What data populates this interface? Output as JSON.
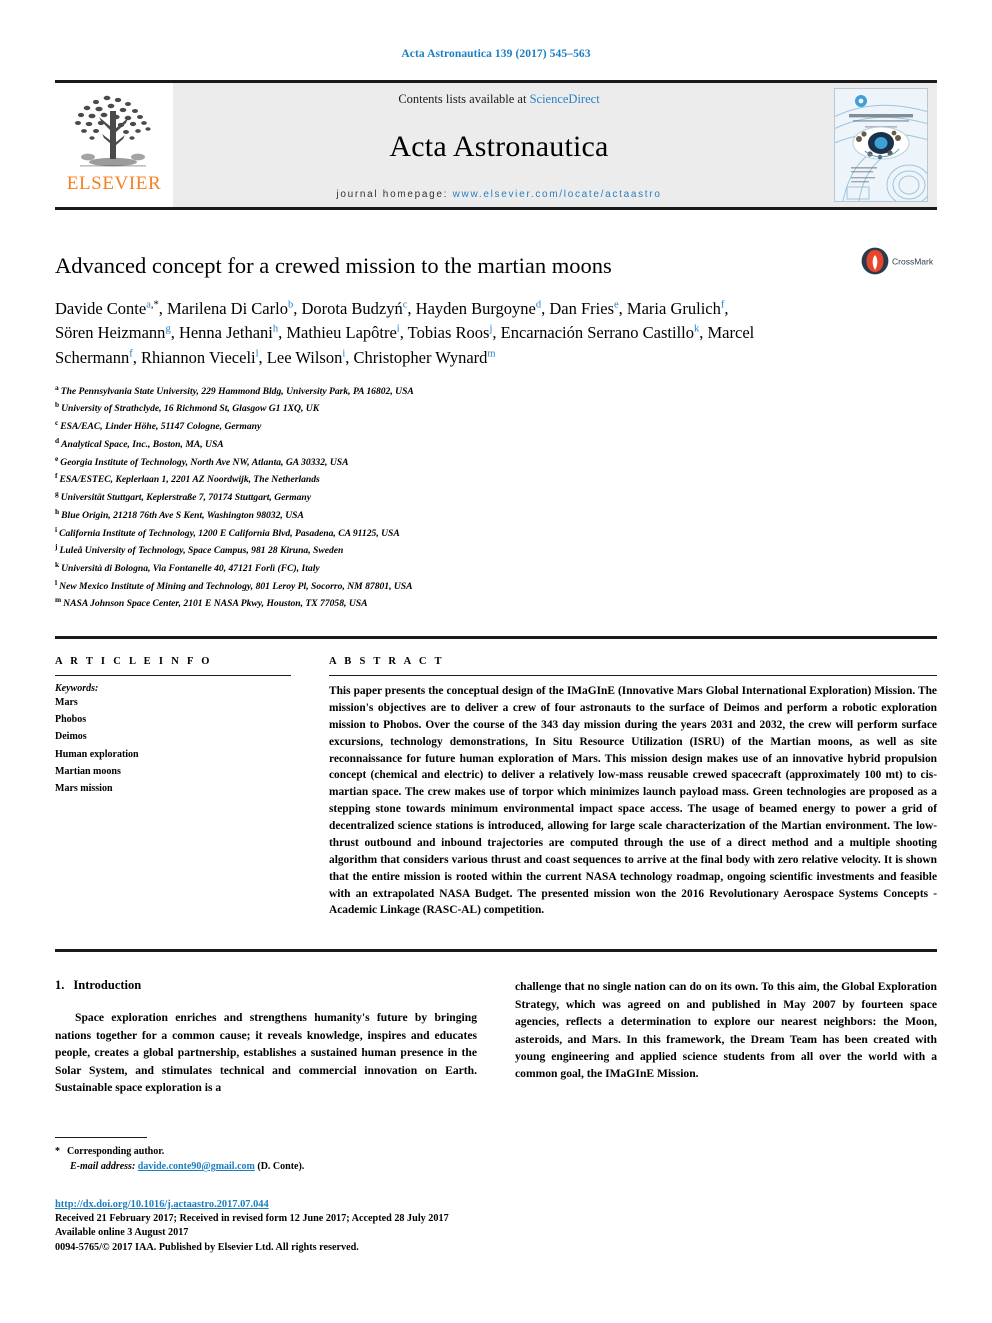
{
  "running_head": "Acta Astronautica 139 (2017) 545–563",
  "masthead": {
    "publisher_name": "ELSEVIER",
    "publisher_logo_icon": "elsevier-tree-icon",
    "contents_prefix": "Contents lists available at",
    "contents_link": "ScienceDirect",
    "journal_title": "Acta Astronautica",
    "homepage_label": "journal homepage:",
    "homepage_url": "www.elsevier.com/locate/actaastro",
    "cover_icon": "journal-cover-thumbnail"
  },
  "article": {
    "title": "Advanced concept for a crewed mission to the martian moons",
    "crossmark_label": "CrossMark",
    "crossmark_icon": "crossmark-badge-icon",
    "authors": [
      {
        "name": "Davide Conte",
        "marks": "a",
        "star": true,
        "sep": ", "
      },
      {
        "name": "Marilena Di Carlo",
        "marks": "b",
        "sep": ", "
      },
      {
        "name": "Dorota Budzyń",
        "marks": "c",
        "sep": ", "
      },
      {
        "name": "Hayden Burgoyne",
        "marks": "d",
        "sep": ", "
      },
      {
        "name": "Dan Fries",
        "marks": "e",
        "sep": ", "
      },
      {
        "name": "Maria Grulich",
        "marks": "f",
        "sep": ", "
      },
      {
        "name": "Sören Heizmann",
        "marks": "g",
        "sep": ", "
      },
      {
        "name": "Henna Jethani",
        "marks": "h",
        "sep": ", "
      },
      {
        "name": "Mathieu Lapôtre",
        "marks": "i",
        "sep": ", "
      },
      {
        "name": "Tobias Roos",
        "marks": "j",
        "sep": ", "
      },
      {
        "name": "Encarnación Serrano Castillo",
        "marks": "k",
        "sep": ", "
      },
      {
        "name": "Marcel Schermann",
        "marks": "f",
        "sep": ", "
      },
      {
        "name": "Rhiannon Vieceli",
        "marks": "l",
        "sep": ", "
      },
      {
        "name": "Lee Wilson",
        "marks": "i",
        "sep": ", "
      },
      {
        "name": "Christopher Wynard",
        "marks": "m",
        "sep": ""
      }
    ],
    "affiliations": [
      {
        "mark": "a",
        "text": "The Pennsylvania State University, 229 Hammond Bldg, University Park, PA 16802, USA"
      },
      {
        "mark": "b",
        "text": "University of Strathclyde, 16 Richmond St, Glasgow G1 1XQ, UK"
      },
      {
        "mark": "c",
        "text": "ESA/EAC, Linder Höhe, 51147 Cologne, Germany"
      },
      {
        "mark": "d",
        "text": "Analytical Space, Inc., Boston, MA, USA"
      },
      {
        "mark": "e",
        "text": "Georgia Institute of Technology, North Ave NW, Atlanta, GA 30332, USA"
      },
      {
        "mark": "f",
        "text": "ESA/ESTEC, Keplerlaan 1, 2201 AZ Noordwijk, The Netherlands"
      },
      {
        "mark": "g",
        "text": "Universität Stuttgart, Keplerstraße 7, 70174 Stuttgart, Germany"
      },
      {
        "mark": "h",
        "text": "Blue Origin, 21218 76th Ave S Kent, Washington 98032, USA"
      },
      {
        "mark": "i",
        "text": "California Institute of Technology, 1200 E California Blvd, Pasadena, CA 91125, USA"
      },
      {
        "mark": "j",
        "text": "Luleå University of Technology, Space Campus, 981 28 Kiruna, Sweden"
      },
      {
        "mark": "k",
        "text": "Università di Bologna, Via Fontanelle 40, 47121 Forlì (FC), Italy"
      },
      {
        "mark": "l",
        "text": "New Mexico Institute of Mining and Technology, 801 Leroy Pl, Socorro, NM 87801, USA"
      },
      {
        "mark": "m",
        "text": "NASA Johnson Space Center, 2101 E NASA Pkwy, Houston, TX 77058, USA"
      }
    ]
  },
  "article_info": {
    "heading": "A R T I C L E   I N F O",
    "keywords_label": "Keywords:",
    "keywords": [
      "Mars",
      "Phobos",
      "Deimos",
      "Human exploration",
      "Martian moons",
      "Mars mission"
    ]
  },
  "abstract": {
    "heading": "A B S T R A C T",
    "text": "This paper presents the conceptual design of the IMaGInE (Innovative Mars Global International Exploration) Mission. The mission's objectives are to deliver a crew of four astronauts to the surface of Deimos and perform a robotic exploration mission to Phobos. Over the course of the 343 day mission during the years 2031 and 2032, the crew will perform surface excursions, technology demonstrations, In Situ Resource Utilization (ISRU) of the Martian moons, as well as site reconnaissance for future human exploration of Mars. This mission design makes use of an innovative hybrid propulsion concept (chemical and electric) to deliver a relatively low-mass reusable crewed spacecraft (approximately 100 mt) to cis-martian space. The crew makes use of torpor which minimizes launch payload mass. Green technologies are proposed as a stepping stone towards minimum environmental impact space access. The usage of beamed energy to power a grid of decentralized science stations is introduced, allowing for large scale characterization of the Martian environment. The low-thrust outbound and inbound trajectories are computed through the use of a direct method and a multiple shooting algorithm that considers various thrust and coast sequences to arrive at the final body with zero relative velocity. It is shown that the entire mission is rooted within the current NASA technology roadmap, ongoing scientific investments and feasible with an extrapolated NASA Budget. The presented mission won the 2016 Revolutionary Aerospace Systems Concepts - Academic Linkage (RASC-AL) competition."
  },
  "body": {
    "section_number": "1.",
    "section_title": "Introduction",
    "column_left": "Space exploration enriches and strengthens humanity's future by bringing nations together for a common cause; it reveals knowledge, inspires and educates people, creates a global partnership, establishes a sustained human presence in the Solar System, and stimulates technical and commercial innovation on Earth. Sustainable space exploration is a",
    "column_right": "challenge that no single nation can do on its own. To this aim, the Global Exploration Strategy, which was agreed on and published in May 2007 by fourteen space agencies, reflects a determination to explore our nearest neighbors: the Moon, asteroids, and Mars. In this framework, the Dream Team has been created with young engineering and applied science students from all over the world with a common goal, the IMaGInE Mission."
  },
  "footer": {
    "corresponding_star": "*",
    "corresponding_label": "Corresponding author.",
    "email_label": "E-mail address:",
    "email": "davide.conte90@gmail.com",
    "email_suffix": "(D. Conte).",
    "doi": "http://dx.doi.org/10.1016/j.actaastro.2017.07.044",
    "received_line": "Received 21 February 2017; Received in revised form 12 June 2017; Accepted 28 July 2017",
    "available_line": "Available online 3 August 2017",
    "copyright_line": "0094-5765/© 2017 IAA. Published by Elsevier Ltd. All rights reserved."
  },
  "colors": {
    "link_blue": "#1b7ec2",
    "elsevier_orange": "#f48020",
    "masthead_gray": "#ececec",
    "rule_black": "#1a1a1a",
    "crossmark_red": "#e8462c"
  }
}
